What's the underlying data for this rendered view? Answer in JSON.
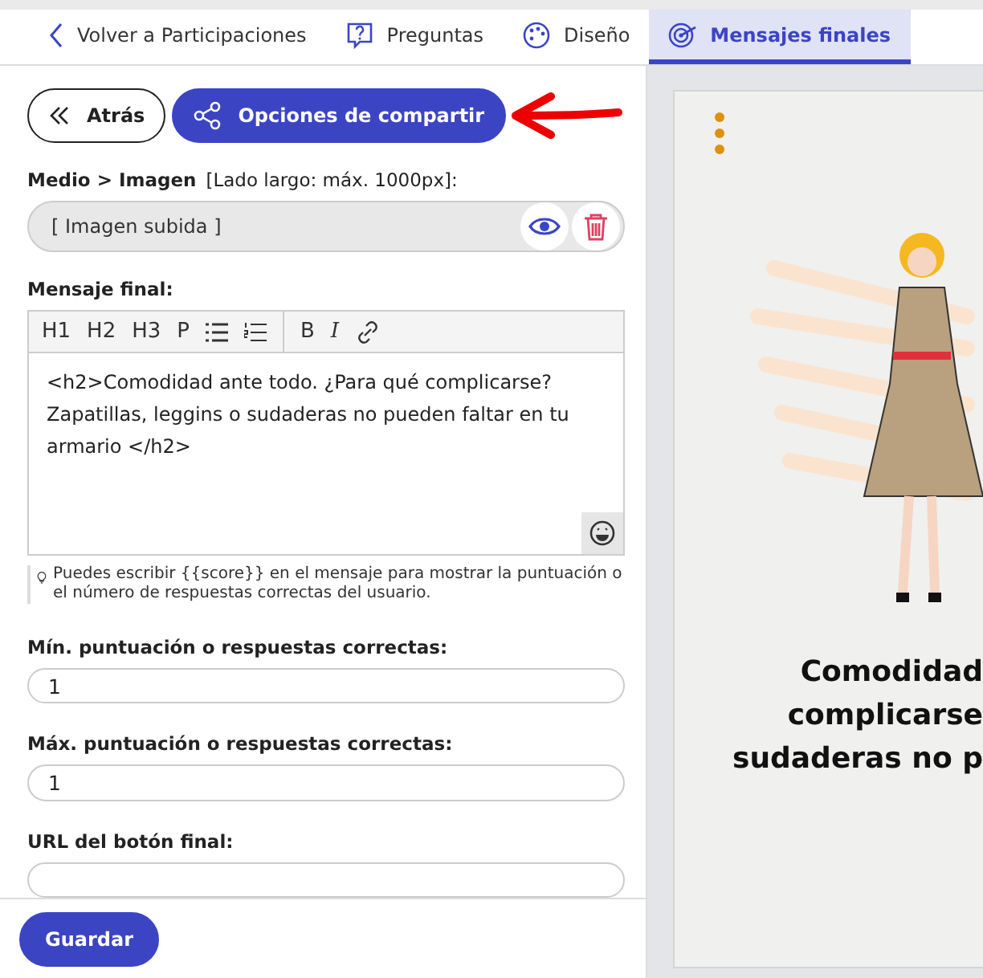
{
  "nav": {
    "back_link": "Volver a Participaciones",
    "tabs": [
      {
        "label": "Preguntas",
        "selected": false
      },
      {
        "label": "Diseño",
        "selected": false
      },
      {
        "label": "Mensajes finales",
        "selected": true
      }
    ]
  },
  "actions": {
    "back": "Atrás",
    "share": "Opciones de compartir"
  },
  "media": {
    "label": "Medio > Imagen",
    "hint": "[Lado largo: máx. 1000px]:",
    "value": "[ Imagen subida ]"
  },
  "message": {
    "label": "Mensaje final:",
    "headings": [
      "H1",
      "H2",
      "H3",
      "P"
    ],
    "formats": [
      "B",
      "I"
    ],
    "text": "<h2>Comodidad ante todo. ¿Para qué complicarse? Zapatillas, leggins o sudaderas no pueden faltar en tu armario </h2>",
    "tip": "Puedes escribir {{score}} en el mensaje para mostrar la puntuación o el número de respuestas correctas del usuario."
  },
  "fields": [
    {
      "label": "Mín. puntuación o respuestas correctas:",
      "value": "1"
    },
    {
      "label": "Máx. puntuación o respuestas correctas:",
      "value": "1"
    },
    {
      "label": "URL del botón final:"
    }
  ],
  "save": "Guardar",
  "preview": {
    "heading_lines": [
      "Comodidad",
      "complicarse",
      "sudaderas no p"
    ]
  }
}
